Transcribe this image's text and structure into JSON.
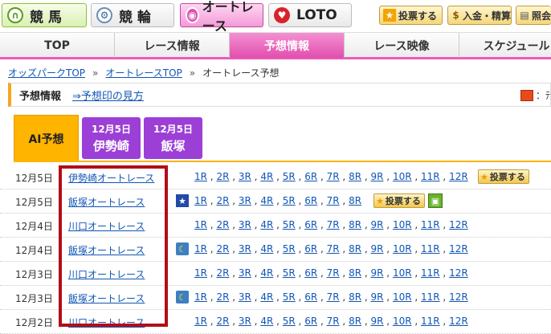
{
  "services": {
    "keiba": {
      "label": "競 馬",
      "icon": "horseshoe-icon",
      "glyph": "∩"
    },
    "keirin": {
      "label": "競 輪",
      "icon": "bicycle-icon",
      "glyph": "⚙"
    },
    "autorace": {
      "label": "オートレース",
      "icon": "auto-race-icon",
      "glyph": "◉"
    },
    "loto": {
      "label": "LOTO",
      "icon": "loto-heart-icon",
      "glyph": "♥"
    }
  },
  "top_buttons": {
    "vote": {
      "label": "投票する",
      "glyph": "★"
    },
    "deposit": {
      "label": "入金・精算",
      "glyph": "$"
    },
    "inquiry": {
      "label": "照会",
      "glyph": "▤"
    }
  },
  "nav": [
    "TOP",
    "レース情報",
    "予想情報",
    "レース映像",
    "スケジュール"
  ],
  "breadcrumb": {
    "home": "オッズパークTOP",
    "sep": "»",
    "autorace": "オートレースTOP",
    "current": "オートレース予想"
  },
  "section": {
    "title": "予想情報",
    "link": "⇒予想印の見方",
    "right_text": "：ﾃ"
  },
  "tabs": {
    "ai": "AI予想",
    "t1": {
      "date": "12月5日",
      "venue": "伊勢崎"
    },
    "t2": {
      "date": "12月5日",
      "venue": "飯塚"
    }
  },
  "race_labels": [
    "1R",
    "2R",
    "3R",
    "4R",
    "5R",
    "6R",
    "7R",
    "8R",
    "9R",
    "10R",
    "11R",
    "12R"
  ],
  "vote_label": "投票する",
  "rows": [
    {
      "date": "12月5日",
      "venue": "伊勢崎オートレース",
      "mark": "",
      "count": 12,
      "vote": true,
      "gift": false
    },
    {
      "date": "12月5日",
      "venue": "飯塚オートレース",
      "mark": "star",
      "count": 8,
      "vote": true,
      "gift": true
    },
    {
      "date": "12月4日",
      "venue": "川口オートレース",
      "mark": "",
      "count": 12,
      "vote": false,
      "gift": false
    },
    {
      "date": "12月4日",
      "venue": "飯塚オートレース",
      "mark": "moon",
      "count": 12,
      "vote": false,
      "gift": false
    },
    {
      "date": "12月3日",
      "venue": "川口オートレース",
      "mark": "",
      "count": 12,
      "vote": false,
      "gift": false
    },
    {
      "date": "12月3日",
      "venue": "飯塚オートレース",
      "mark": "moon",
      "count": 12,
      "vote": false,
      "gift": false
    },
    {
      "date": "12月2日",
      "venue": "川口オートレース",
      "mark": "",
      "count": 12,
      "vote": false,
      "gift": false
    }
  ],
  "colors": {
    "accent_pink": "#e95cb8",
    "ai_orange": "#ffb400",
    "tab_purple": "#9c3fd6",
    "link_blue": "#1156b5",
    "highlight_red": "#b30d18"
  }
}
